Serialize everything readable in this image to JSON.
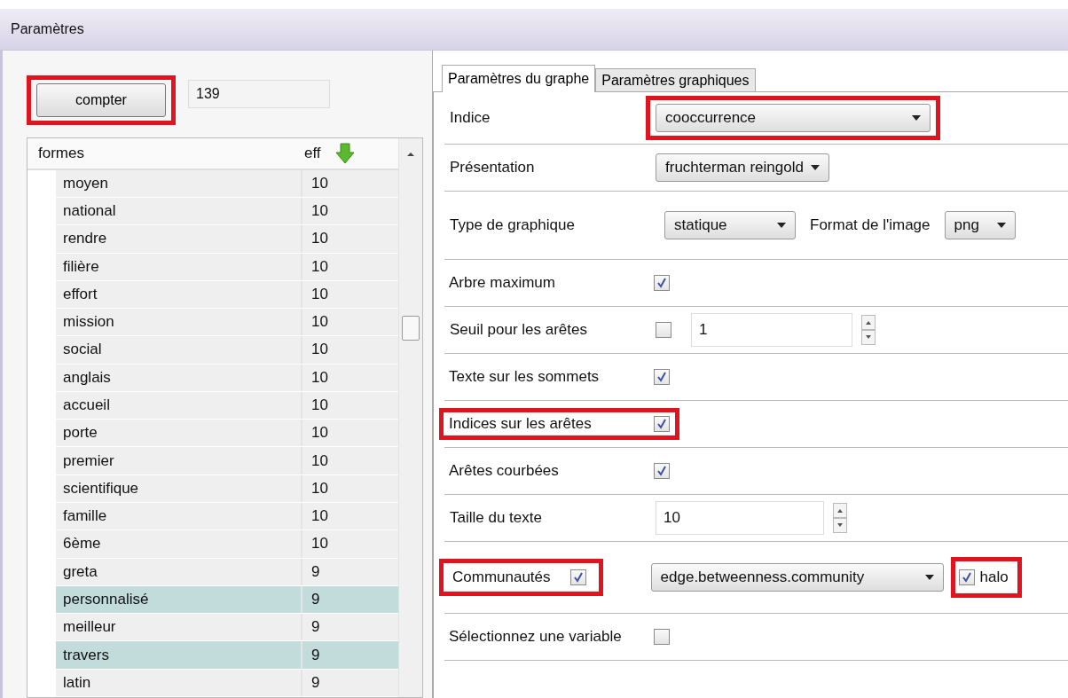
{
  "window": {
    "title": "Paramètres"
  },
  "count_button": {
    "label": "compter",
    "highlighted": true
  },
  "count_value": "139",
  "table": {
    "columns": [
      "formes",
      "eff"
    ],
    "rows": [
      {
        "forme": "moyen",
        "eff": "10",
        "selected": false
      },
      {
        "forme": "national",
        "eff": "10",
        "selected": false
      },
      {
        "forme": "rendre",
        "eff": "10",
        "selected": false
      },
      {
        "forme": "filière",
        "eff": "10",
        "selected": false
      },
      {
        "forme": "effort",
        "eff": "10",
        "selected": false
      },
      {
        "forme": "mission",
        "eff": "10",
        "selected": false
      },
      {
        "forme": "social",
        "eff": "10",
        "selected": false
      },
      {
        "forme": "anglais",
        "eff": "10",
        "selected": false
      },
      {
        "forme": "accueil",
        "eff": "10",
        "selected": false
      },
      {
        "forme": "porte",
        "eff": "10",
        "selected": false
      },
      {
        "forme": "premier",
        "eff": "10",
        "selected": false
      },
      {
        "forme": "scientifique",
        "eff": "10",
        "selected": false
      },
      {
        "forme": "famille",
        "eff": "10",
        "selected": false
      },
      {
        "forme": "6ème",
        "eff": "10",
        "selected": false
      },
      {
        "forme": "greta",
        "eff": "9",
        "selected": false
      },
      {
        "forme": "personnalisé",
        "eff": "9",
        "selected": true
      },
      {
        "forme": "meilleur",
        "eff": "9",
        "selected": false
      },
      {
        "forme": "travers",
        "eff": "9",
        "selected": true
      },
      {
        "forme": "latin",
        "eff": "9",
        "selected": false
      }
    ]
  },
  "tabs": [
    {
      "label": "Paramètres du graphe",
      "selected": true
    },
    {
      "label": "Paramètres graphiques",
      "selected": false
    }
  ],
  "settings": [
    {
      "kind": "select",
      "label": "Indice",
      "value": "cooccurrence",
      "highlighted": true
    },
    {
      "kind": "select",
      "label": "Présentation",
      "value": "fruchterman reingold",
      "highlighted": false
    },
    {
      "kind": "select2",
      "label": "Type de graphique",
      "value": "statique",
      "label2": "Format de l'image",
      "value2": "png"
    },
    {
      "kind": "check",
      "label": "Arbre maximum",
      "checked": true,
      "highlighted": false
    },
    {
      "kind": "spincheck",
      "label": "Seuil pour les arêtes",
      "checked": false,
      "value": "1"
    },
    {
      "kind": "check",
      "label": "Texte sur les sommets",
      "checked": true,
      "highlighted": false
    },
    {
      "kind": "check",
      "label": "Indices sur les arêtes",
      "checked": true,
      "highlighted": true
    },
    {
      "kind": "check",
      "label": "Arêtes courbées",
      "checked": true,
      "highlighted": false
    },
    {
      "kind": "spin",
      "label": "Taille du texte",
      "value": "10"
    },
    {
      "kind": "community",
      "label": "Communautés",
      "checked": true,
      "highlighted": true,
      "value": "edge.betweenness.community",
      "halo": {
        "label": "halo",
        "checked": true,
        "highlighted": true
      }
    },
    {
      "kind": "check",
      "label": "Sélectionnez une variable",
      "checked": false,
      "highlighted": false
    }
  ]
}
